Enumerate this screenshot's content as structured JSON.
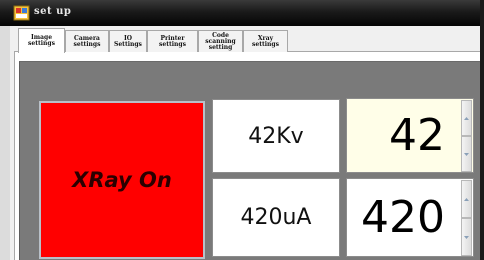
{
  "window": {
    "title": "set up"
  },
  "tabs": [
    {
      "label": "Image settings",
      "active": true
    },
    {
      "label": "Camera settings",
      "active": false
    },
    {
      "label": "IO Settings",
      "active": false
    },
    {
      "label": "Printer settings",
      "active": false
    },
    {
      "label": "Code scanning setting",
      "active": false
    },
    {
      "label": "Xray settings",
      "active": false
    }
  ],
  "xray": {
    "button_label": "XRay On",
    "button_color": "#ff0000"
  },
  "readouts": {
    "voltage": "42Kv",
    "current": "420uA"
  },
  "setpoints": {
    "voltage": "42",
    "current": "420"
  },
  "colors": {
    "panel": "#7a7a7a",
    "voltage_setpoint_bg": "#fffee8",
    "titlebar": "#0a0a0a"
  }
}
